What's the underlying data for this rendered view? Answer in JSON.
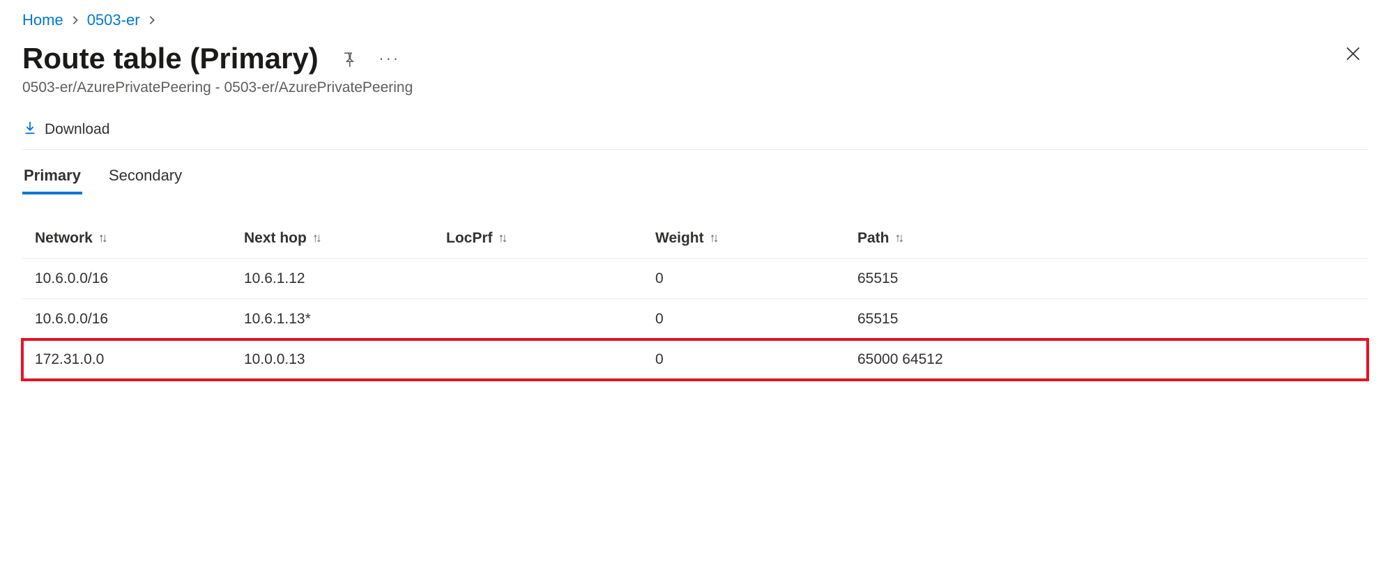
{
  "breadcrumb": {
    "items": [
      "Home",
      "0503-er"
    ]
  },
  "header": {
    "title": "Route table (Primary)",
    "subtitle": "0503-er/AzurePrivatePeering - 0503-er/AzurePrivatePeering"
  },
  "toolbar": {
    "download_label": "Download"
  },
  "tabs": {
    "items": [
      {
        "label": "Primary",
        "active": true
      },
      {
        "label": "Secondary",
        "active": false
      }
    ]
  },
  "table": {
    "columns": [
      "Network",
      "Next hop",
      "LocPrf",
      "Weight",
      "Path"
    ],
    "rows": [
      {
        "network": "10.6.0.0/16",
        "next_hop": "10.6.1.12",
        "locprf": "",
        "weight": "0",
        "path": "65515",
        "highlight": false
      },
      {
        "network": "10.6.0.0/16",
        "next_hop": "10.6.1.13*",
        "locprf": "",
        "weight": "0",
        "path": "65515",
        "highlight": false
      },
      {
        "network": "172.31.0.0",
        "next_hop": "10.0.0.13",
        "locprf": "",
        "weight": "0",
        "path": "65000 64512",
        "highlight": true
      }
    ]
  }
}
